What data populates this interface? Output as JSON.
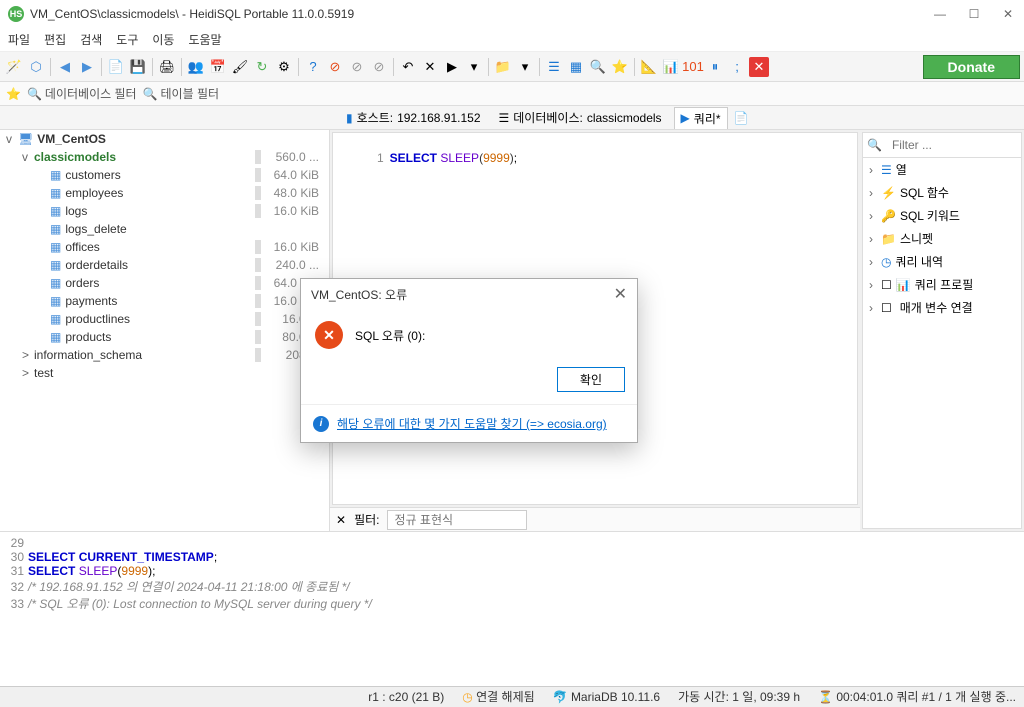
{
  "window": {
    "title": "VM_CentOS\\classicmodels\\ - HeidiSQL Portable 11.0.0.5919"
  },
  "menu": [
    "파일",
    "편집",
    "검색",
    "도구",
    "이동",
    "도움말"
  ],
  "donate_label": "Donate",
  "filterbar": {
    "db_filter": "데이터베이스 필터",
    "table_filter": "테이블 필터"
  },
  "tabs": {
    "host_label": "호스트:",
    "host_value": "192.168.91.152",
    "db_label": "데이터베이스:",
    "db_value": "classicmodels",
    "query_label": "쿼리*"
  },
  "tree": [
    {
      "indent": 0,
      "toggle": "v",
      "icon": "🖥",
      "label": "VM_CentOS",
      "bold": true,
      "size": ""
    },
    {
      "indent": 1,
      "toggle": "v",
      "icon": "",
      "label": "classicmodels",
      "green": true,
      "size": "560.0 ..."
    },
    {
      "indent": 2,
      "toggle": "",
      "icon": "▦",
      "label": "customers",
      "size": "64.0 KiB"
    },
    {
      "indent": 2,
      "toggle": "",
      "icon": "▦",
      "label": "employees",
      "size": "48.0 KiB"
    },
    {
      "indent": 2,
      "toggle": "",
      "icon": "▦",
      "label": "logs",
      "size": "16.0 KiB"
    },
    {
      "indent": 2,
      "toggle": "",
      "icon": "▦",
      "label": "logs_delete",
      "size": ""
    },
    {
      "indent": 2,
      "toggle": "",
      "icon": "▦",
      "label": "offices",
      "size": "16.0 KiB"
    },
    {
      "indent": 2,
      "toggle": "",
      "icon": "▦",
      "label": "orderdetails",
      "size": "240.0 ..."
    },
    {
      "indent": 2,
      "toggle": "",
      "icon": "▦",
      "label": "orders",
      "size": "64.0 KiB"
    },
    {
      "indent": 2,
      "toggle": "",
      "icon": "▦",
      "label": "payments",
      "size": "16.0 KiB"
    },
    {
      "indent": 2,
      "toggle": "",
      "icon": "▦",
      "label": "productlines",
      "size": "16.0 ..."
    },
    {
      "indent": 2,
      "toggle": "",
      "icon": "▦",
      "label": "products",
      "size": "80.0 ..."
    },
    {
      "indent": 1,
      "toggle": ">",
      "icon": "",
      "label": "information_schema",
      "size": "208 ..."
    },
    {
      "indent": 1,
      "toggle": ">",
      "icon": "",
      "label": "test",
      "size": ""
    }
  ],
  "sql": {
    "line_no": "1",
    "kw_select": "SELECT",
    "func": "SLEEP",
    "open": "(",
    "num": "9999",
    "close": ")",
    "semi": ";"
  },
  "rightpanel": {
    "filter_placeholder": "Filter ...",
    "items": [
      "열",
      "SQL 함수",
      "SQL 키워드",
      "스니펫",
      "쿼리 내역",
      "쿼리 프로필",
      "매개 변수 연결"
    ]
  },
  "filter_row": {
    "label": "필터:",
    "placeholder": "정규 표현식"
  },
  "log": [
    {
      "n": "29",
      "text": ""
    },
    {
      "n": "30",
      "html": [
        [
          "kw",
          "SELECT"
        ],
        [
          "sp",
          " "
        ],
        [
          "kw",
          "CURRENT_TIMESTAMP"
        ],
        [
          "txt",
          ";"
        ]
      ]
    },
    {
      "n": "31",
      "html": [
        [
          "kw",
          "SELECT"
        ],
        [
          "sp",
          " "
        ],
        [
          "func",
          "SLEEP"
        ],
        [
          "txt",
          "("
        ],
        [
          "num",
          "9999"
        ],
        [
          "txt",
          ");"
        ]
      ]
    },
    {
      "n": "32",
      "comment": "/* 192.168.91.152 의 연결이 2024-04-11 21:18:00 에 종료됨 */"
    },
    {
      "n": "33",
      "comment": "/* SQL 오류 (0): Lost connection to MySQL server during query */"
    }
  ],
  "status": {
    "cursor": "r1 : c20 (21 B)",
    "connection": "연결 해제됨",
    "server": "MariaDB 10.11.6",
    "uptime_label": "가동 시간:",
    "uptime_value": "1 일, 09:39 h",
    "timer": "00:04:01.0",
    "query_info": "쿼리 #1 / 1 개 실행 중..."
  },
  "dialog": {
    "title": "VM_CentOS: 오류",
    "message": "SQL 오류 (0):",
    "ok_label": "확인",
    "help_link": "해당 오류에 대한 몇 가지 도움말 찾기 (=> ecosia.org)"
  }
}
